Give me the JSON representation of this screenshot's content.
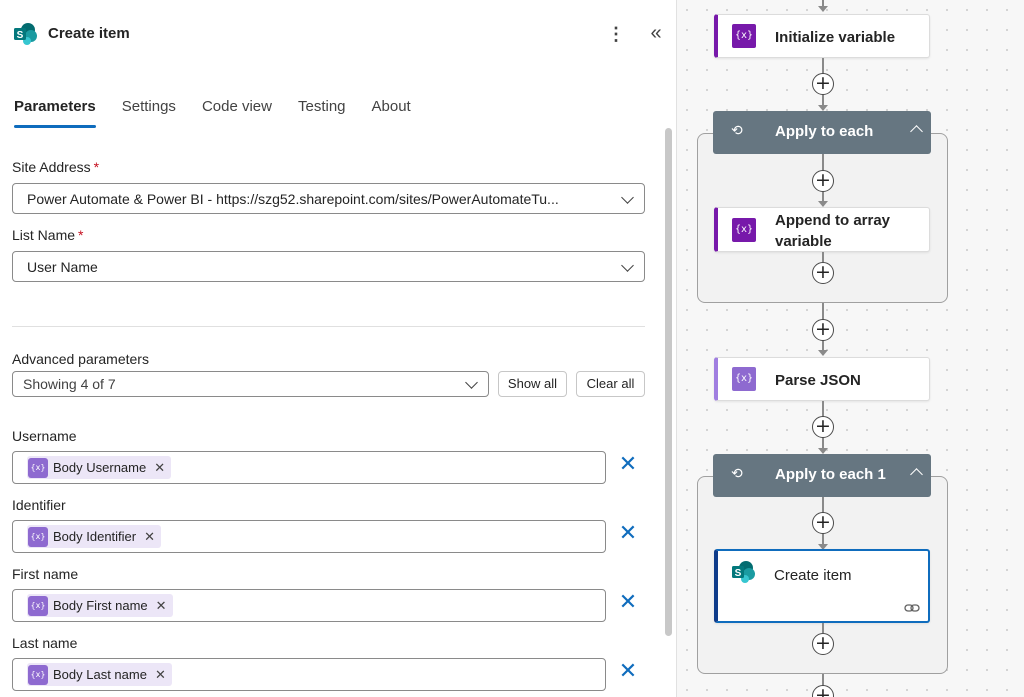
{
  "panel": {
    "title": "Create item",
    "more_glyph": "⋮",
    "collapse_glyph": "«",
    "tabs": [
      {
        "label": "Parameters",
        "active": true
      },
      {
        "label": "Settings"
      },
      {
        "label": "Code view"
      },
      {
        "label": "Testing"
      },
      {
        "label": "About"
      }
    ],
    "site_address": {
      "label": "Site Address",
      "required_mark": "*",
      "value": "Power Automate & Power BI - https://szg52.sharepoint.com/sites/PowerAutomateTu..."
    },
    "list_name": {
      "label": "List Name",
      "required_mark": "*",
      "value": "User Name"
    },
    "advanced": {
      "label": "Advanced parameters",
      "value": "Showing 4 of 7",
      "show_all": "Show all",
      "clear_all": "Clear all"
    },
    "fields": [
      {
        "label": "Username",
        "token": "Body Username"
      },
      {
        "label": "Identifier",
        "token": "Body Identifier"
      },
      {
        "label": "First name",
        "token": "Body First name"
      },
      {
        "label": "Last name",
        "token": "Body Last name"
      }
    ],
    "token_icon_glyph": "{x}",
    "token_remove_glyph": "✕",
    "clear_field_glyph": "✕"
  },
  "canvas": {
    "plus_glyph": "+",
    "var_icon_glyph": "{x}",
    "loop_glyph": "⟲",
    "nodes": {
      "initialize": "Initialize variable",
      "apply_each": "Apply to each",
      "append_line1": "Append to array",
      "append_line2": "variable",
      "parse_json": "Parse JSON",
      "apply_each_1": "Apply to each 1",
      "create_item": "Create item"
    }
  },
  "colors": {
    "accent": "#0f6cbd",
    "variable_action": "#7719aa",
    "token_bg": "#ece6f7",
    "scope_header": "#667681",
    "sharepoint": "#038387"
  }
}
